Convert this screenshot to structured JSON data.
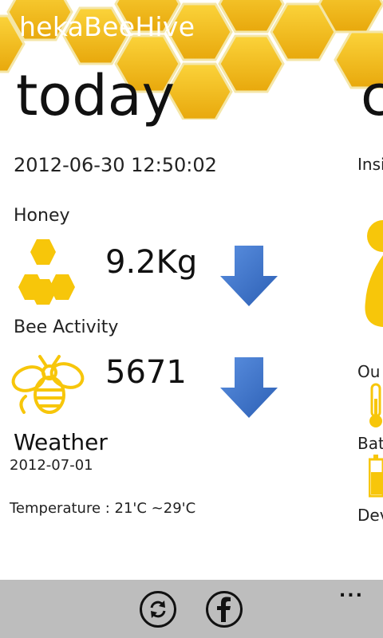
{
  "app": {
    "title": "hekaBeeHive"
  },
  "panorama": {
    "current_title": "today",
    "next_title_peek": "c"
  },
  "today": {
    "timestamp": "2012-06-30 12:50:02",
    "honey": {
      "label": "Honey",
      "value": "9.2Kg",
      "trend_icon": "arrow-down-icon"
    },
    "bee_activity": {
      "label": "Bee Activity",
      "value": "5671",
      "trend_icon": "arrow-down-icon"
    },
    "weather": {
      "title": "Weather",
      "date": "2012-07-01",
      "temperature": "Temperature : 21'C ~29'C"
    }
  },
  "next_panel_peek": {
    "labels": [
      "Insi",
      "Ou",
      "Bat",
      "Dev"
    ]
  },
  "app_bar": {
    "buttons": [
      {
        "name": "refresh-button",
        "icon": "refresh-icon"
      },
      {
        "name": "facebook-button",
        "icon": "facebook-icon"
      }
    ],
    "more": "..."
  },
  "colors": {
    "honey_yellow": "#F7C60A",
    "honey_dark": "#E3A308",
    "arrow_blue": "#3B73C8",
    "app_bar": "#BDBDBD"
  }
}
